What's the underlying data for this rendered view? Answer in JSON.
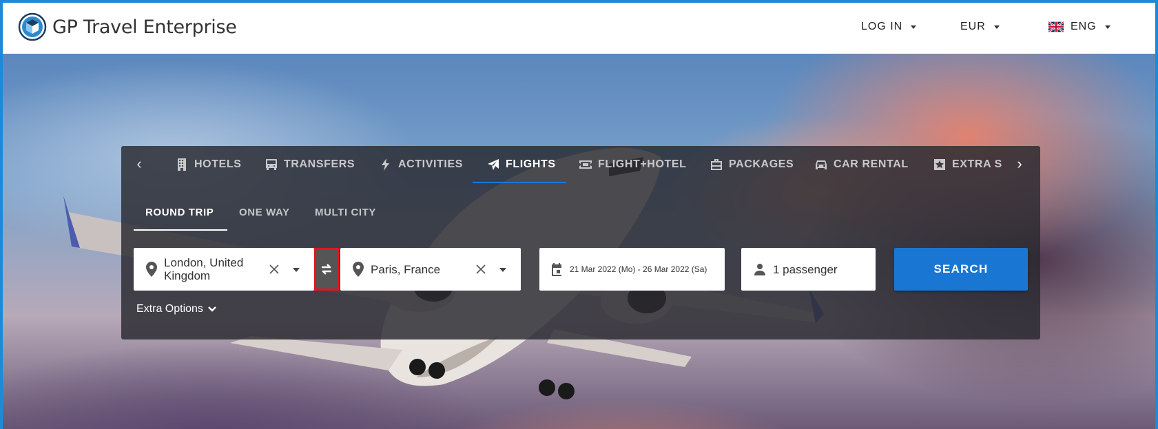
{
  "header": {
    "brand": "GP Travel Enterprise",
    "login_label": "LOG IN",
    "currency_label": "EUR",
    "language_label": "ENG"
  },
  "nav": {
    "tabs": [
      {
        "label": "HOTELS",
        "icon": "building-icon"
      },
      {
        "label": "TRANSFERS",
        "icon": "bus-icon"
      },
      {
        "label": "ACTIVITIES",
        "icon": "bolt-icon"
      },
      {
        "label": "FLIGHTS",
        "icon": "plane-icon",
        "active": true
      },
      {
        "label": "FLIGHT+HOTEL",
        "icon": "ticket-icon"
      },
      {
        "label": "PACKAGES",
        "icon": "briefcase-icon"
      },
      {
        "label": "CAR RENTAL",
        "icon": "car-icon"
      },
      {
        "label": "EXTRA S",
        "icon": "star-icon"
      }
    ]
  },
  "trip_types": [
    {
      "label": "ROUND TRIP",
      "active": true
    },
    {
      "label": "ONE WAY"
    },
    {
      "label": "MULTI CITY"
    }
  ],
  "search": {
    "origin_line1": "London, United",
    "origin_line2": "Kingdom",
    "destination": "Paris, France",
    "dates": "21 Mar 2022 (Mo) -  26 Mar 2022 (Sa)",
    "passengers": "1 passenger",
    "search_label": "SEARCH",
    "extra_options_label": "Extra Options"
  },
  "colors": {
    "accent": "#1976d2",
    "frame": "#1c8ad8",
    "highlight": "#e6141b"
  }
}
